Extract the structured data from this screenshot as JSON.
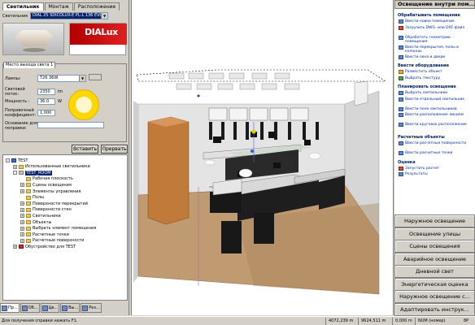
{
  "left_panel": {
    "tabs": [
      "Светильник",
      "Монтаж",
      "Расположение"
    ],
    "luminaire_label": "Светильник",
    "luminaire_value": "DIAL 25 SDICOLUX-E PL-L 136 EVG",
    "logo_text": "DIALux",
    "group_tab": "Место выхода света 1",
    "lamps_label": "Лампы:",
    "lamps_value": "T26 36W",
    "flux_label": "Световой поток:",
    "flux_value": "2350",
    "flux_unit": "lm",
    "power_label": "Мощность :",
    "power_value": "36.0",
    "power_unit": "W",
    "correction_label": "Поправочный коэффициент:",
    "correction_value": "1.000",
    "reason_label": "Основание для поправки:",
    "insert_button": "Вставить",
    "cancel_button": "Прервать"
  },
  "tree": [
    {
      "label": "TEST",
      "indent": 0,
      "pm": "-",
      "icon": "blue"
    },
    {
      "label": "Использованные светильники",
      "indent": 1,
      "pm": "+",
      "icon": "folder"
    },
    {
      "label": "TEST_ROOM",
      "indent": 1,
      "pm": "-",
      "icon": "room",
      "selected": true
    },
    {
      "label": "Рабочая плоскость",
      "indent": 2,
      "pm": "",
      "icon": "folder"
    },
    {
      "label": "Сцены освещения",
      "indent": 2,
      "pm": "+",
      "icon": "folder"
    },
    {
      "label": "Элементы управления",
      "indent": 2,
      "pm": "+",
      "icon": "folder"
    },
    {
      "label": "Полы",
      "indent": 2,
      "pm": "",
      "icon": "folder"
    },
    {
      "label": "Поверхности перекрытий",
      "indent": 2,
      "pm": "+",
      "icon": "folder"
    },
    {
      "label": "Поверхности стен",
      "indent": 2,
      "pm": "+",
      "icon": "folder"
    },
    {
      "label": "Светильники",
      "indent": 2,
      "pm": "+",
      "icon": "folder"
    },
    {
      "label": "Объекты",
      "indent": 2,
      "pm": "+",
      "icon": "folder"
    },
    {
      "label": "Выбрать элемент помещения",
      "indent": 2,
      "pm": "+",
      "icon": "folder"
    },
    {
      "label": "Расчетные точки",
      "indent": 2,
      "pm": "+",
      "icon": "folder"
    },
    {
      "label": "Расчетные поверхности",
      "indent": 2,
      "pm": "+",
      "icon": "folder"
    },
    {
      "label": "Обустройство для TEST",
      "indent": 1,
      "pm": "+",
      "icon": "red"
    }
  ],
  "bottom_tabs": [
    "Пр...",
    "Об...",
    "Цв...",
    "Вы...",
    "Рез..."
  ],
  "right_panel": {
    "header": "Освещение внутри пом...",
    "sections": [
      {
        "title": "Обрабатывать помещение",
        "items": [
          {
            "label": "Ввести новое помещение",
            "icon": "b"
          },
          {
            "label": "Загрузить DWG- или DXF-файл",
            "icon": "r"
          },
          {
            "label": "Обработать геометрию помещения",
            "icon": "b"
          },
          {
            "label": "Ввести перекрытия, полы и колонны",
            "icon": "b"
          },
          {
            "label": "Ввести окна и двери",
            "icon": "b"
          }
        ]
      },
      {
        "title": "Ввести оборудование",
        "items": [
          {
            "label": "Разместить объект",
            "icon": "y"
          },
          {
            "label": "Выбрать текстуру",
            "icon": "g"
          }
        ]
      },
      {
        "title": "Планировать освещение",
        "items": [
          {
            "label": "Выбрать светильники",
            "icon": "b"
          },
          {
            "label": "Ввести отдельный светильник",
            "icon": "b"
          },
          {
            "label": "Ввести поле светильников",
            "icon": "b"
          },
          {
            "label": "Ввести расположение линиям",
            "icon": "b"
          },
          {
            "label": "Ввести круговое расположение",
            "icon": "b"
          }
        ]
      },
      {
        "title": "Расчетные объекты",
        "items": [
          {
            "label": "Ввести расчетные поверхности",
            "icon": "b"
          },
          {
            "label": "Ввести расчетные точки",
            "icon": "b"
          }
        ]
      },
      {
        "title": "Оценка",
        "items": [
          {
            "label": "Запустить расчет",
            "icon": "r"
          },
          {
            "label": "Результаты",
            "icon": "b"
          }
        ]
      }
    ],
    "buttons": [
      "Наружное освещение",
      "Освещение улицы",
      "Сцены освещения",
      "Аварийное освещение",
      "Дневной свет",
      "Энергетическая оценка",
      "Наружное освещение с...",
      "Адаптировать инструк..."
    ]
  },
  "status": {
    "help": "Для получения справки нажать F1.",
    "x": "4072,239 m",
    "y": "9624,511 m",
    "z": "0,000 m",
    "mode": "NUM (номер)",
    "extra": "8P"
  }
}
